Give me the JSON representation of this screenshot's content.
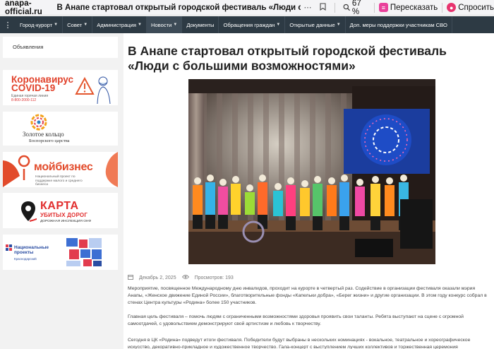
{
  "browser": {
    "domain": "anapa-official.ru",
    "page_title": "В Анапе стартовал открытый городской фестиваль «Люди с большими возм…",
    "zoom": "67 %",
    "retell_label": "Пересказать",
    "ask_label": "Спросить"
  },
  "nav": {
    "items": [
      {
        "label": "Город-курорт",
        "dropdown": true
      },
      {
        "label": "Совет",
        "dropdown": true
      },
      {
        "label": "Администрация",
        "dropdown": true
      },
      {
        "label": "Новости",
        "dropdown": true
      },
      {
        "label": "Документы",
        "dropdown": false
      },
      {
        "label": "Обращения граждан",
        "dropdown": true
      },
      {
        "label": "Открытые данные",
        "dropdown": true
      },
      {
        "label": "Доп. меры поддержки участникам СВО",
        "dropdown": false
      }
    ]
  },
  "sidebar": {
    "link": "Объявления",
    "covid": {
      "title_line1": "Коронавирус",
      "title_line2": "COVID-19",
      "hotline": "Единая горячая линия",
      "phone": "8-800-2000-112"
    },
    "ring": {
      "title": "Золотое кольцо",
      "subtitle": "Боспорского царства"
    },
    "biz": {
      "title": "мойбизнес",
      "subtitle": "Национальный проект по поддержке малого и среднего бизнеса"
    },
    "karta": {
      "line1": "КАРТА",
      "line2": "УБИТЫХ ДОРОГ",
      "line3": "ДОРОЖНАЯ ИНСПЕКЦИЯ ОНФ"
    },
    "national": {
      "title": "Национальные проекты",
      "subtitle": "Краснодарский"
    }
  },
  "article": {
    "title": "В Анапе стартовал открытый городской фестиваль «Люди с большими возможностями»",
    "date": "Декабрь 2, 2025",
    "views": "Просмотров: 193",
    "paragraphs": [
      "Мероприятие, посвященное Международному дню инвалидов, проходит на курорте в четвертый раз. Содействие в организации фестиваля оказали мэрия Анапы, «Женское движение Единой России», благотворительные фонды «Капельки добра», «Берег жизни» и другие организации. В этом году конкурс собрал в стенах Центра культуры «Родина» более 150 участников.",
      "Главная цель фестиваля – помочь людям с ограниченными возможностями здоровья проявить свои таланты. Ребята выступают на сцене с огромной самоотдачей, с удовольствием демонстрируют свой артистизм и любовь к творчеству.",
      "Сегодня в ЦК «Родина» подведут итоги фестиваля. Победители будут выбраны в нескольких номинациях - вокальное, театральное и хореографическое искусство, декоративно-прикладное и художественное творчество. Гала-концерт с выступлением лучших коллективов и торжественная церемония награждения"
    ]
  },
  "colors": {
    "nav_bg": "#2d3a44",
    "accent_red": "#e1412a",
    "page_bg": "#ffffff",
    "sidebar_bg": "#f2f2f2"
  }
}
